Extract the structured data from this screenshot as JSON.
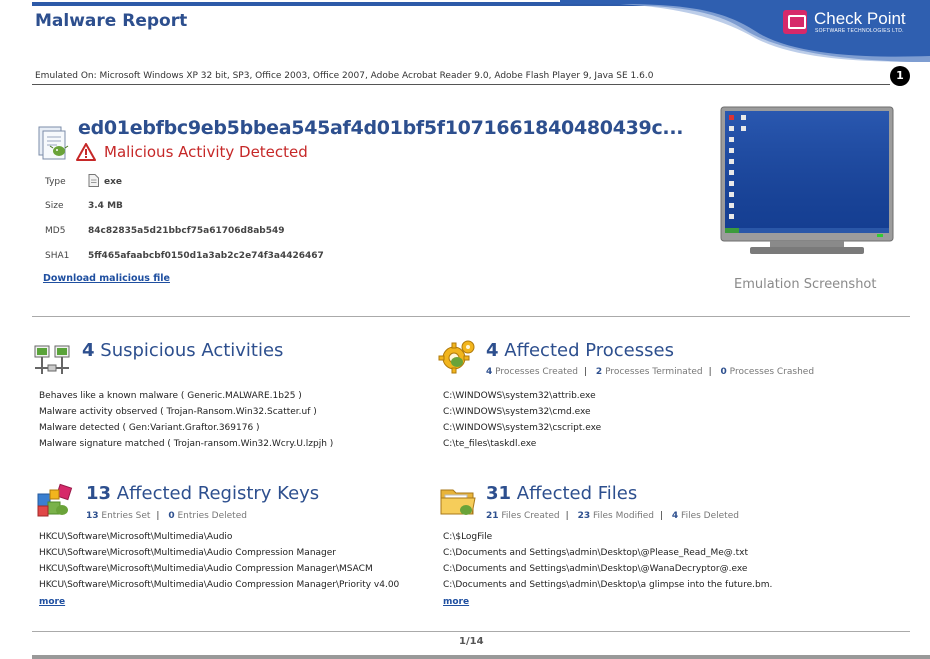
{
  "header": {
    "title": "Malware Report",
    "logo_name": "Check Point",
    "logo_sub": "SOFTWARE TECHNOLOGIES LTD."
  },
  "emulated_on": "Emulated On: Microsoft Windows XP 32 bit, SP3, Office 2003, Office 2007, Adobe Acrobat Reader 9.0, Adobe Flash Player 9, Java SE 1.6.0",
  "page_marker": "1",
  "sample": {
    "hash_title": "ed01ebfbc9eb5bbea545af4d01bf5f1071661840480439c...",
    "verdict": "Malicious Activity Detected",
    "props": [
      {
        "label": "Type",
        "value": "exe"
      },
      {
        "label": "Size",
        "value": "3.4 MB"
      },
      {
        "label": "MD5",
        "value": "84c82835a5d21bbcf75a61706d8ab549"
      },
      {
        "label": "SHA1",
        "value": "5ff465afaabcbf0150d1a3ab2c2e74f3a4426467"
      }
    ],
    "download_label": "Download malicious file"
  },
  "screenshot_caption": "Emulation Screenshot",
  "suspicious": {
    "count": "4",
    "title": "Suspicious Activities",
    "items": [
      "Behaves like a known malware ( Generic.MALWARE.1b25 )",
      "Malware activity observed ( Trojan-Ransom.Win32.Scatter.uf )",
      "Malware detected ( Gen:Variant.Graftor.369176 )",
      "Malware signature matched ( Trojan-ransom.Win32.Wcry.U.lzpjh )"
    ]
  },
  "processes": {
    "count": "4",
    "title": "Affected Processes",
    "stats": [
      {
        "num": "4",
        "label": "Processes Created"
      },
      {
        "num": "2",
        "label": "Processes Terminated"
      },
      {
        "num": "0",
        "label": "Processes Crashed"
      }
    ],
    "items": [
      "C:\\WINDOWS\\system32\\attrib.exe",
      "C:\\WINDOWS\\system32\\cmd.exe",
      "C:\\WINDOWS\\system32\\cscript.exe",
      "C:\\te_files\\taskdl.exe"
    ]
  },
  "registry": {
    "count": "13",
    "title": "Affected Registry Keys",
    "stats": [
      {
        "num": "13",
        "label": "Entries Set"
      },
      {
        "num": "0",
        "label": "Entries Deleted"
      }
    ],
    "items": [
      "HKCU\\Software\\Microsoft\\Multimedia\\Audio",
      "HKCU\\Software\\Microsoft\\Multimedia\\Audio Compression Manager",
      "HKCU\\Software\\Microsoft\\Multimedia\\Audio Compression Manager\\MSACM",
      "HKCU\\Software\\Microsoft\\Multimedia\\Audio Compression Manager\\Priority v4.00"
    ],
    "more_label": "more"
  },
  "files": {
    "count": "31",
    "title": "Affected Files",
    "stats": [
      {
        "num": "21",
        "label": "Files Created"
      },
      {
        "num": "23",
        "label": "Files Modified"
      },
      {
        "num": "4",
        "label": "Files Deleted"
      }
    ],
    "items": [
      "C:\\$LogFile",
      "C:\\Documents and Settings\\admin\\Desktop\\@Please_Read_Me@.txt",
      "C:\\Documents and Settings\\admin\\Desktop\\@WanaDecryptor@.exe",
      "C:\\Documents and Settings\\admin\\Desktop\\a glimpse into the future.bm."
    ],
    "more_label": "more"
  },
  "footer": {
    "page": "1/14"
  },
  "colors": {
    "accent": "#2d4f8e",
    "alert": "#c62828",
    "link": "#1f4fa0",
    "brand_pink": "#d6296a"
  }
}
